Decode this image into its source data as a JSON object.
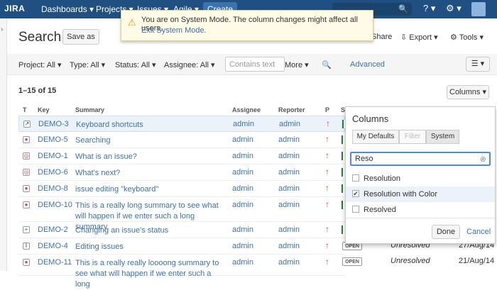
{
  "topbar": {
    "logo": "JIRA",
    "nav": [
      "Dashboards ▾",
      "Projects ▾",
      "Issues ▾",
      "Agile ▾"
    ],
    "create": "Create"
  },
  "banner": {
    "line1": "You are on System Mode. The column changes might affect all users.",
    "line2": "Exit System Mode."
  },
  "page": {
    "title": "Search",
    "save_as": "Save as",
    "share": "Share",
    "export": "Export ▾",
    "tools": "Tools ▾"
  },
  "filters": {
    "project": "Project: All ▾",
    "type": "Type: All ▾",
    "status": "Status: All ▾",
    "assignee": "Assignee: All ▾",
    "text_placeholder": "Contains text",
    "more": "More ▾",
    "advanced": "Advanced"
  },
  "results": {
    "count": "1–15 of 15",
    "columns_button": "Columns ▾"
  },
  "table": {
    "headers": [
      "T",
      "Key",
      "Summary",
      "Assignee",
      "Reporter",
      "P",
      "S"
    ],
    "rows": [
      {
        "key": "DEMO-3",
        "summary": "Keyboard shortcuts",
        "assignee": "admin",
        "reporter": "admin",
        "icon": "↗"
      },
      {
        "key": "DEMO-5",
        "summary": "Searching",
        "assignee": "admin",
        "reporter": "admin",
        "icon": "●"
      },
      {
        "key": "DEMO-1",
        "summary": "What is an issue?",
        "assignee": "admin",
        "reporter": "admin",
        "icon": "◎"
      },
      {
        "key": "DEMO-6",
        "summary": "What's next?",
        "assignee": "admin",
        "reporter": "admin",
        "icon": "◎"
      },
      {
        "key": "DEMO-8",
        "summary": "issue editing \"keyboard\"",
        "assignee": "admin",
        "reporter": "admin",
        "icon": "●"
      },
      {
        "key": "DEMO-10",
        "summary": "This is a really long summary to see what will happen if we enter such a long summary",
        "assignee": "admin",
        "reporter": "admin",
        "icon": "●"
      },
      {
        "key": "DEMO-2",
        "summary": "Changing an issue's status",
        "assignee": "admin",
        "reporter": "admin",
        "icon": "+"
      },
      {
        "key": "DEMO-4",
        "summary": "Editing issues",
        "assignee": "admin",
        "reporter": "admin",
        "icon": "I",
        "status": "OPEN",
        "resolution": "Unresolved",
        "date": "27/Aug/14"
      },
      {
        "key": "DEMO-11",
        "summary": "This is a really really loooong summary to see what will happen if we enter such a long",
        "assignee": "admin",
        "reporter": "admin",
        "icon": "●",
        "status": "OPEN",
        "resolution": "Unresolved",
        "date": "21/Aug/14"
      }
    ]
  },
  "columns_popup": {
    "title": "Columns",
    "tabs": [
      "My Defaults",
      "Filter",
      "System"
    ],
    "search_value": "Reso",
    "options": [
      {
        "label": "Resolution",
        "checked": false
      },
      {
        "label": "Resolution with Color",
        "checked": true
      },
      {
        "label": "Resolved",
        "checked": false
      }
    ],
    "done": "Done",
    "cancel": "Cancel"
  }
}
